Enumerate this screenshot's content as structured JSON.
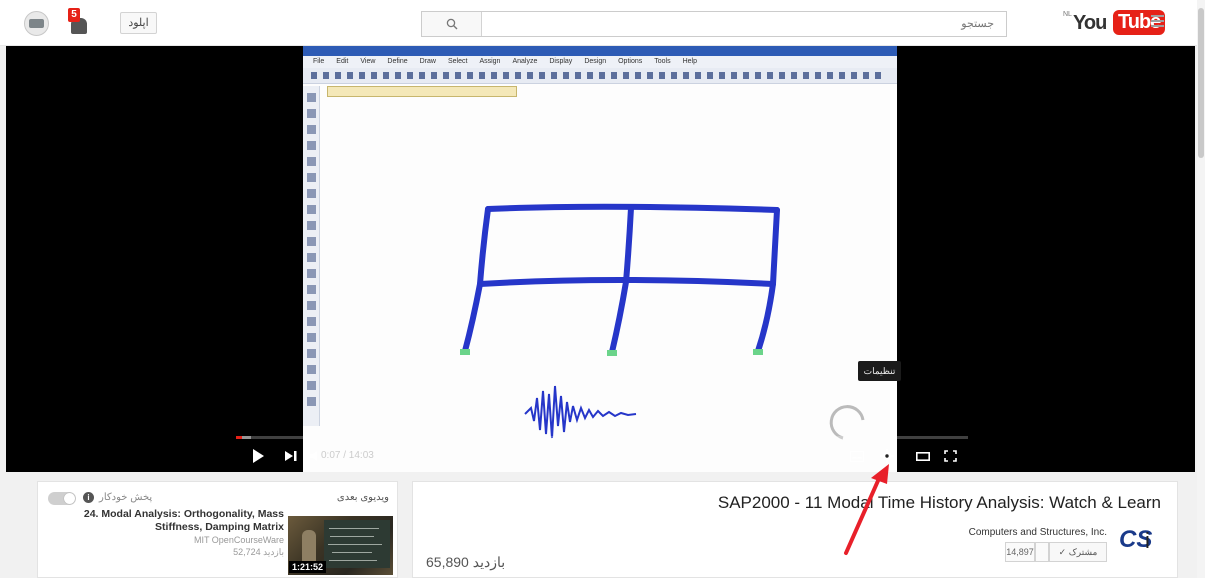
{
  "masthead": {
    "upload_label": "اپلود",
    "notification_count": "5",
    "search_placeholder": "جستجو",
    "logo_country": "NL",
    "logo_you": "You",
    "logo_tube": "Tube"
  },
  "player": {
    "time": "0:07 / 14:03",
    "settings_tooltip": "تنظیمات",
    "progress_played_fraction": 0.008,
    "progress_loaded_fraction": 0.02,
    "sap_menu": [
      "File",
      "Edit",
      "View",
      "Define",
      "Draw",
      "Select",
      "Assign",
      "Analyze",
      "Display",
      "Design",
      "Options",
      "Tools",
      "Help"
    ]
  },
  "sidebar": {
    "up_next_label": "ویدیوی بعدی",
    "autoplay_label": "پخش خودکار",
    "info_glyph": "i",
    "recommendation": {
      "title": "24. Modal Analysis: Orthogonality, Mass Stiffness, Damping Matrix",
      "channel": "MIT OpenCourseWare",
      "views": "52,724 بازدید",
      "duration": "1:21:52"
    }
  },
  "watch": {
    "title": "SAP2000 - 11 Modal Time History Analysis: Watch & Learn",
    "channel_name": "Computers and Structures, Inc.",
    "channel_logo_cs": "CS",
    "channel_logo_i": "i",
    "subscribe_label": "✓ مشترک",
    "subscriber_count": "14,897",
    "view_count": "65,890 بازدید"
  },
  "colors": {
    "accent_red": "#e62117",
    "frame_blue": "#2636c9",
    "annotation_arrow": "#e8202a"
  },
  "icons": [
    "avatar-icon",
    "notification-bell-icon",
    "search-icon",
    "guide-menu-icon",
    "play-icon",
    "next-icon",
    "volume-icon",
    "subtitles-icon",
    "settings-gear-icon",
    "theater-mode-icon",
    "fullscreen-icon",
    "info-icon",
    "channel-logo-icon"
  ]
}
